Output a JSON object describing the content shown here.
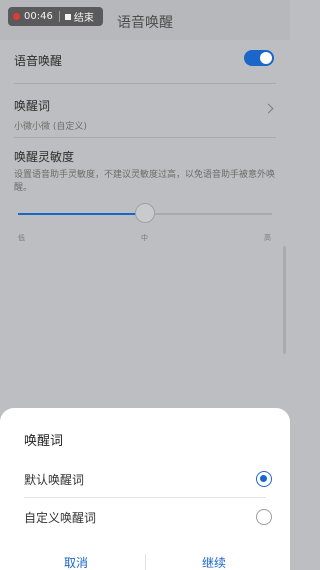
{
  "status": {
    "time": "00:46",
    "action": "结束"
  },
  "header": {
    "title": "语音唤醒"
  },
  "settings": {
    "voice_wakeup": {
      "label": "语音唤醒",
      "enabled": true
    },
    "wake_word": {
      "label": "唤醒词",
      "value": "小微小微 (自定义)"
    },
    "sensitivity": {
      "label": "唤醒灵敏度",
      "description": "设置语音助手灵敏度，不建议灵敏度过高，以免语音助手被意外唤醒。",
      "level": 0.5,
      "ticks": [
        "低",
        "中",
        "高"
      ]
    }
  },
  "sheet": {
    "title": "唤醒词",
    "options": [
      {
        "label": "默认唤醒词",
        "selected": true
      },
      {
        "label": "自定义唤醒词",
        "selected": false
      }
    ],
    "cancel": "取消",
    "continue": "继续"
  },
  "colors": {
    "accent": "#1a66c9"
  }
}
